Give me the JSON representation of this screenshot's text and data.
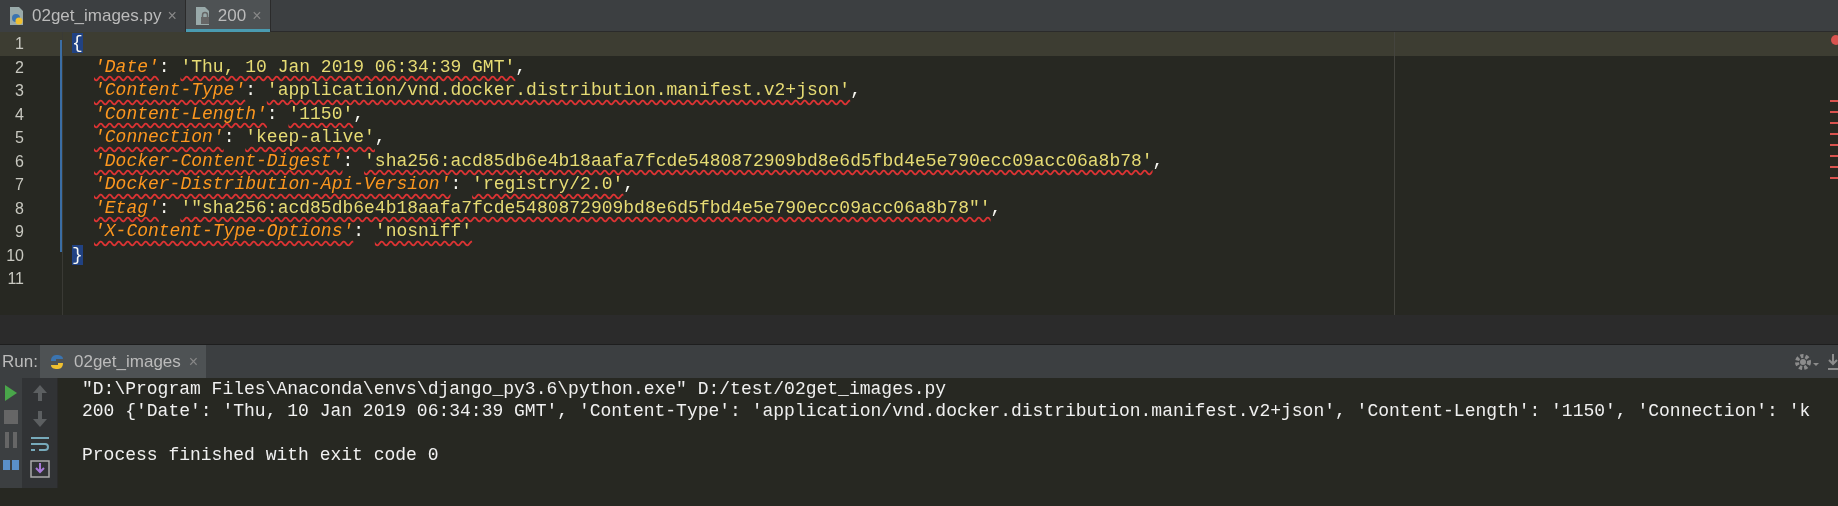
{
  "editor_tabs": [
    {
      "label": "02get_images.py",
      "kind": "python",
      "selected": false,
      "close": "×"
    },
    {
      "label": "200",
      "kind": "locked",
      "selected": true,
      "close": "×"
    }
  ],
  "code_lines": [
    {
      "number": "1",
      "current": true,
      "tokens": [
        {
          "kind": "brace",
          "text": "{"
        }
      ]
    },
    {
      "number": "2",
      "current": false,
      "tokens": [
        {
          "kind": "key",
          "text": "'Date'"
        },
        {
          "kind": "punct",
          "text": ": "
        },
        {
          "kind": "string",
          "text": "'Thu, 10 Jan 2019 06:34:39 GMT'"
        },
        {
          "kind": "punct",
          "text": ","
        }
      ]
    },
    {
      "number": "3",
      "current": false,
      "tokens": [
        {
          "kind": "key",
          "text": "'Content-Type'"
        },
        {
          "kind": "punct",
          "text": ": "
        },
        {
          "kind": "string",
          "text": "'application/vnd.docker.distribution.manifest.v2+json'"
        },
        {
          "kind": "punct",
          "text": ","
        }
      ]
    },
    {
      "number": "4",
      "current": false,
      "tokens": [
        {
          "kind": "key",
          "text": "'Content-Length'"
        },
        {
          "kind": "punct",
          "text": ": "
        },
        {
          "kind": "string",
          "text": "'1150'"
        },
        {
          "kind": "punct",
          "text": ","
        }
      ]
    },
    {
      "number": "5",
      "current": false,
      "tokens": [
        {
          "kind": "key",
          "text": "'Connection'"
        },
        {
          "kind": "punct",
          "text": ": "
        },
        {
          "kind": "string",
          "text": "'keep-alive'"
        },
        {
          "kind": "punct",
          "text": ","
        }
      ]
    },
    {
      "number": "6",
      "current": false,
      "tokens": [
        {
          "kind": "key",
          "text": "'Docker-Content-Digest'"
        },
        {
          "kind": "punct",
          "text": ": "
        },
        {
          "kind": "string",
          "text": "'sha256:acd85db6e4b18aafa7fcde5480872909bd8e6d5fbd4e5e790ecc09acc06a8b78'"
        },
        {
          "kind": "punct",
          "text": ","
        }
      ]
    },
    {
      "number": "7",
      "current": false,
      "tokens": [
        {
          "kind": "key",
          "text": "'Docker-Distribution-Api-Version'"
        },
        {
          "kind": "punct",
          "text": ": "
        },
        {
          "kind": "string",
          "text": "'registry/2.0'"
        },
        {
          "kind": "punct",
          "text": ","
        }
      ]
    },
    {
      "number": "8",
      "current": false,
      "tokens": [
        {
          "kind": "key",
          "text": "'Etag'"
        },
        {
          "kind": "punct",
          "text": ": "
        },
        {
          "kind": "string",
          "text": "'\"sha256:acd85db6e4b18aafa7fcde5480872909bd8e6d5fbd4e5e790ecc09acc06a8b78\"'"
        },
        {
          "kind": "punct",
          "text": ","
        }
      ]
    },
    {
      "number": "9",
      "current": false,
      "tokens": [
        {
          "kind": "key",
          "text": "'X-Content-Type-Options'"
        },
        {
          "kind": "punct",
          "text": ": "
        },
        {
          "kind": "string",
          "text": "'nosniff'"
        }
      ]
    },
    {
      "number": "10",
      "current": false,
      "tokens": [
        {
          "kind": "brace",
          "text": "}"
        }
      ]
    },
    {
      "number": "11",
      "current": false
    }
  ],
  "run_panel": {
    "label": "Run:",
    "tab": {
      "label": "02get_images",
      "selected": true,
      "close": "×"
    },
    "console_lines": [
      {
        "kind": "command",
        "text": "\"D:\\Program Files\\Anaconda\\envs\\django_py3.6\\python.exe\" D:/test/02get_images.py"
      },
      {
        "kind": "output",
        "text": "200 {'Date': 'Thu, 10 Jan 2019 06:34:39 GMT', 'Content-Type': 'application/vnd.docker.distribution.manifest.v2+json', 'Content-Length': '1150', 'Connection': 'k"
      },
      {
        "kind": "status",
        "text": "Process finished with exit code 0"
      }
    ]
  }
}
